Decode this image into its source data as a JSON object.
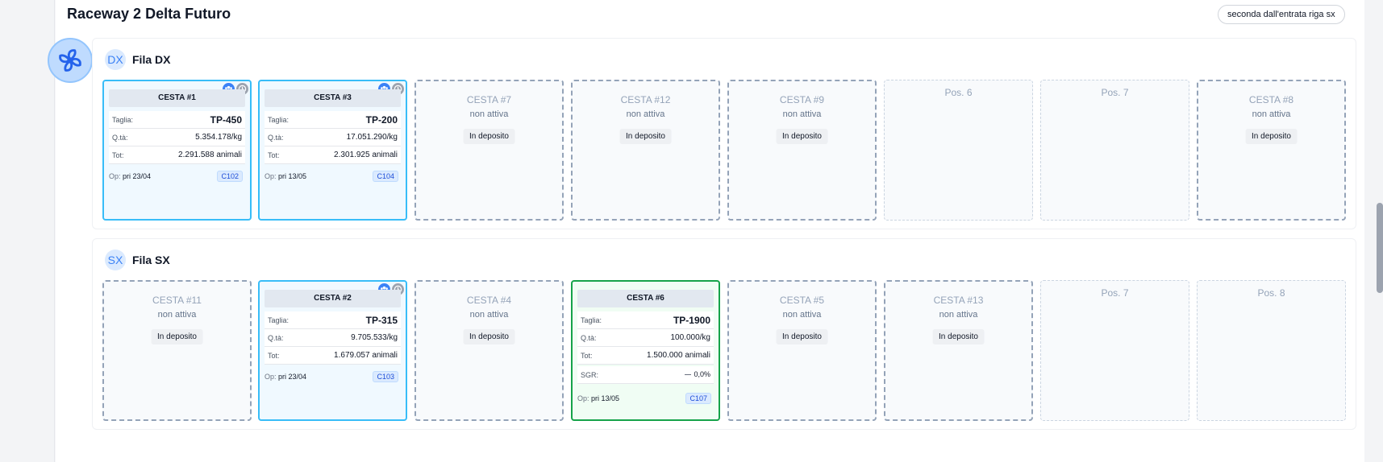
{
  "raceway": {
    "title": "Raceway 2 Delta Futuro",
    "note": "seconda dall'entrata riga sx"
  },
  "icons": {
    "fan": "fan-icon",
    "group": "group-icon",
    "clock": "clock-icon"
  },
  "colors": {
    "active_border": "#38bdf8",
    "sgr_border": "#16a34a",
    "badge_bg": "#dbeafe",
    "accent": "#3b82f6"
  },
  "labels": {
    "size": "Taglia:",
    "qty": "Q.tà:",
    "tot": "Tot:",
    "sgr": "SGR:",
    "op": "Op:",
    "inactive": "non attiva",
    "deposit": "In deposito"
  },
  "rows": [
    {
      "badge": "DX",
      "label": "Fila DX",
      "slots": [
        {
          "kind": "active",
          "title": "CESTA #1",
          "size": "TP-450",
          "qty": "5.354.178/kg",
          "tot": "2.291.588 animali",
          "op": "pri 23/04",
          "code": "C102"
        },
        {
          "kind": "active",
          "title": "CESTA #3",
          "size": "TP-200",
          "qty": "17.051.290/kg",
          "tot": "2.301.925 animali",
          "op": "pri 13/05",
          "code": "C104"
        },
        {
          "kind": "inactive",
          "title": "CESTA #7"
        },
        {
          "kind": "inactive",
          "title": "CESTA #12"
        },
        {
          "kind": "inactive",
          "title": "CESTA #9"
        },
        {
          "kind": "empty",
          "title": "Pos. 6"
        },
        {
          "kind": "empty",
          "title": "Pos. 7"
        },
        {
          "kind": "inactive",
          "title": "CESTA #8"
        }
      ]
    },
    {
      "badge": "SX",
      "label": "Fila SX",
      "slots": [
        {
          "kind": "inactive",
          "title": "CESTA #11"
        },
        {
          "kind": "active",
          "title": "CESTA #2",
          "size": "TP-315",
          "qty": "9.705.533/kg",
          "tot": "1.679.057 animali",
          "op": "pri 23/04",
          "code": "C103"
        },
        {
          "kind": "inactive",
          "title": "CESTA #4"
        },
        {
          "kind": "sgr",
          "title": "CESTA #6",
          "size": "TP-1900",
          "qty": "100.000/kg",
          "tot": "1.500.000 animali",
          "sgr": "0,0%",
          "op": "pri 13/05",
          "code": "C107"
        },
        {
          "kind": "inactive",
          "title": "CESTA #5"
        },
        {
          "kind": "inactive",
          "title": "CESTA #13"
        },
        {
          "kind": "empty",
          "title": "Pos. 7"
        },
        {
          "kind": "empty",
          "title": "Pos. 8"
        }
      ]
    }
  ]
}
